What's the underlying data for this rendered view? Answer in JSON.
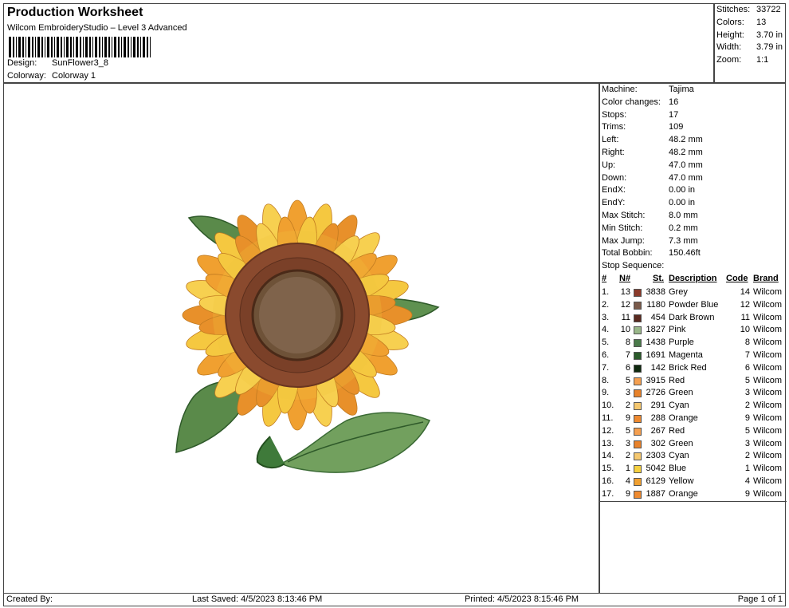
{
  "header": {
    "title": "Production Worksheet",
    "subtitle": "Wilcom EmbroideryStudio – Level 3 Advanced",
    "design_label": "Design:",
    "design_value": "SunFlower3_8",
    "colorway_label": "Colorway:",
    "colorway_value": "Colorway 1"
  },
  "stats": [
    {
      "label": "Stitches:",
      "value": "33722"
    },
    {
      "label": "Colors:",
      "value": "13"
    },
    {
      "label": "Height:",
      "value": "3.70 in"
    },
    {
      "label": "Width:",
      "value": "3.79 in"
    },
    {
      "label": "Zoom:",
      "value": "1:1"
    }
  ],
  "details": [
    {
      "label": "Machine:",
      "value": "Tajima"
    },
    {
      "label": "Color changes:",
      "value": "16"
    },
    {
      "label": "Stops:",
      "value": "17"
    },
    {
      "label": "Trims:",
      "value": "109"
    },
    {
      "label": "Left:",
      "value": "48.2 mm"
    },
    {
      "label": "Right:",
      "value": "48.2 mm"
    },
    {
      "label": "Up:",
      "value": "47.0 mm"
    },
    {
      "label": "Down:",
      "value": "47.0 mm"
    },
    {
      "label": "EndX:",
      "value": "0.00 in"
    },
    {
      "label": "EndY:",
      "value": "0.00 in"
    },
    {
      "label": "Max Stitch:",
      "value": "8.0 mm"
    },
    {
      "label": "Min Stitch:",
      "value": "0.2 mm"
    },
    {
      "label": "Max Jump:",
      "value": "7.3 mm"
    },
    {
      "label": "Total Bobbin:",
      "value": "150.46ft"
    }
  ],
  "stop_sequence": {
    "title": "Stop Sequence:",
    "headers": {
      "num": "#",
      "n": "N#",
      "st": "St.",
      "desc": "Description",
      "code": "Code",
      "brand": "Brand"
    },
    "rows": [
      {
        "num": "1.",
        "n": "13",
        "color": "#8b3a2a",
        "st": "3838",
        "desc": "Grey",
        "code": "14",
        "brand": "Wilcom"
      },
      {
        "num": "2.",
        "n": "12",
        "color": "#7a5a4a",
        "st": "1180",
        "desc": "Powder Blue",
        "code": "12",
        "brand": "Wilcom"
      },
      {
        "num": "3.",
        "n": "11",
        "color": "#5a2a20",
        "st": "454",
        "desc": "Dark Brown",
        "code": "11",
        "brand": "Wilcom"
      },
      {
        "num": "4.",
        "n": "10",
        "color": "#9ab88a",
        "st": "1827",
        "desc": "Pink",
        "code": "10",
        "brand": "Wilcom"
      },
      {
        "num": "5.",
        "n": "8",
        "color": "#4a7a4a",
        "st": "1438",
        "desc": "Purple",
        "code": "8",
        "brand": "Wilcom"
      },
      {
        "num": "6.",
        "n": "7",
        "color": "#2a5a2a",
        "st": "1691",
        "desc": "Magenta",
        "code": "7",
        "brand": "Wilcom"
      },
      {
        "num": "7.",
        "n": "6",
        "color": "#0f2a0f",
        "st": "142",
        "desc": "Brick Red",
        "code": "6",
        "brand": "Wilcom"
      },
      {
        "num": "8.",
        "n": "5",
        "color": "#f5a050",
        "st": "3915",
        "desc": "Red",
        "code": "5",
        "brand": "Wilcom"
      },
      {
        "num": "9.",
        "n": "3",
        "color": "#e8822a",
        "st": "2726",
        "desc": "Green",
        "code": "3",
        "brand": "Wilcom"
      },
      {
        "num": "10.",
        "n": "2",
        "color": "#f5c870",
        "st": "291",
        "desc": "Cyan",
        "code": "2",
        "brand": "Wilcom"
      },
      {
        "num": "11.",
        "n": "9",
        "color": "#ee8a30",
        "st": "288",
        "desc": "Orange",
        "code": "9",
        "brand": "Wilcom"
      },
      {
        "num": "12.",
        "n": "5",
        "color": "#f5a050",
        "st": "267",
        "desc": "Red",
        "code": "5",
        "brand": "Wilcom"
      },
      {
        "num": "13.",
        "n": "3",
        "color": "#e8822a",
        "st": "302",
        "desc": "Green",
        "code": "3",
        "brand": "Wilcom"
      },
      {
        "num": "14.",
        "n": "2",
        "color": "#f5c870",
        "st": "2303",
        "desc": "Cyan",
        "code": "2",
        "brand": "Wilcom"
      },
      {
        "num": "15.",
        "n": "1",
        "color": "#f5d040",
        "st": "5042",
        "desc": "Blue",
        "code": "1",
        "brand": "Wilcom"
      },
      {
        "num": "16.",
        "n": "4",
        "color": "#f0a030",
        "st": "6129",
        "desc": "Yellow",
        "code": "4",
        "brand": "Wilcom"
      },
      {
        "num": "17.",
        "n": "9",
        "color": "#ee8a30",
        "st": "1887",
        "desc": "Orange",
        "code": "9",
        "brand": "Wilcom"
      }
    ]
  },
  "footer": {
    "created_by": "Created By:",
    "last_saved": "Last Saved: 4/5/2023 8:13:46 PM",
    "printed": "Printed: 4/5/2023 8:15:46 PM",
    "page": "Page 1 of 1"
  }
}
